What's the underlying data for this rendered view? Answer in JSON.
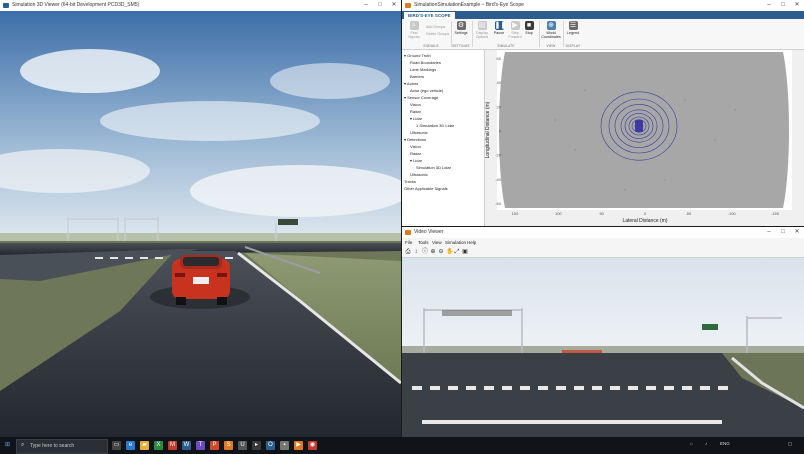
{
  "sim_window": {
    "title": "Simulation 3D Viewer (64-bit Development PCD3D_SM5)",
    "controls": {
      "minimize": "–",
      "maximize": "□",
      "close": "✕"
    }
  },
  "bes_window": {
    "title": "SimulationSimulationExample – Bird's-Eye Scope",
    "tab": "BIRD'S-EYE SCOPE",
    "buttons": {
      "find_signals": "Find\nSignals",
      "add_groups": "Add Groups",
      "delete_groups": "Delete Groups",
      "settings": "Settings",
      "display_options": "Display\nOptions",
      "pause": "Pause",
      "step_forward": "Step\nForward",
      "stop": "Stop",
      "world_coordinates": "World\nCoordinates",
      "legend": "Legend"
    },
    "groups": [
      "SIGNALS",
      "SETTINGS",
      "SIMULATE",
      "VIEW",
      "DISPLAY"
    ],
    "tree": [
      {
        "label": "Ground Truth",
        "level": 0,
        "arrow": "▾"
      },
      {
        "label": "Road Boundaries",
        "level": 1
      },
      {
        "label": "Lane Markings",
        "level": 1
      },
      {
        "label": "Barriers",
        "level": 1
      },
      {
        "label": "Actors",
        "level": 0,
        "arrow": "▾"
      },
      {
        "label": "Actor (ego vehicle)",
        "level": 1
      },
      {
        "label": "Sensor Coverage",
        "level": 0,
        "arrow": "▾"
      },
      {
        "label": "Vision",
        "level": 1
      },
      {
        "label": "Radar",
        "level": 1
      },
      {
        "label": "Lidar",
        "level": 1,
        "arrow": "▾"
      },
      {
        "label": "1 Simulation 3D Lidar",
        "level": 2
      },
      {
        "label": "Ultrasonic",
        "level": 1
      },
      {
        "label": "Detections",
        "level": 0,
        "arrow": "▾"
      },
      {
        "label": "Vision",
        "level": 1
      },
      {
        "label": "Radar",
        "level": 1
      },
      {
        "label": "Lidar",
        "level": 1,
        "arrow": "▾"
      },
      {
        "label": "Simulation 3D Lidar",
        "level": 2
      },
      {
        "label": "Ultrasonic",
        "level": 1
      },
      {
        "label": "Tracks",
        "level": 0
      },
      {
        "label": "Other Applicable Signals",
        "level": 0
      }
    ],
    "plot": {
      "xlabel": "Lateral Distance (m)",
      "ylabel": "Longitudinal Distance (m)",
      "xticks": [
        "150",
        "100",
        "50",
        "0",
        "-50",
        "-100",
        "-150"
      ],
      "yticks": [
        "60",
        "40",
        "20",
        "0",
        "-20",
        "-40",
        "-60"
      ]
    }
  },
  "vv_window": {
    "title": "Video Viewer",
    "menu": [
      "File",
      "Tools",
      "View",
      "Simulation",
      "Help"
    ]
  },
  "taskbar": {
    "search_placeholder": "Type here to search",
    "tray": "ENG"
  },
  "colors": {
    "accent": "#2b5d8e",
    "car_red": "#c8331f",
    "scope_gray": "#a5a5a5",
    "lidar_blue": "#3a3aa0"
  }
}
